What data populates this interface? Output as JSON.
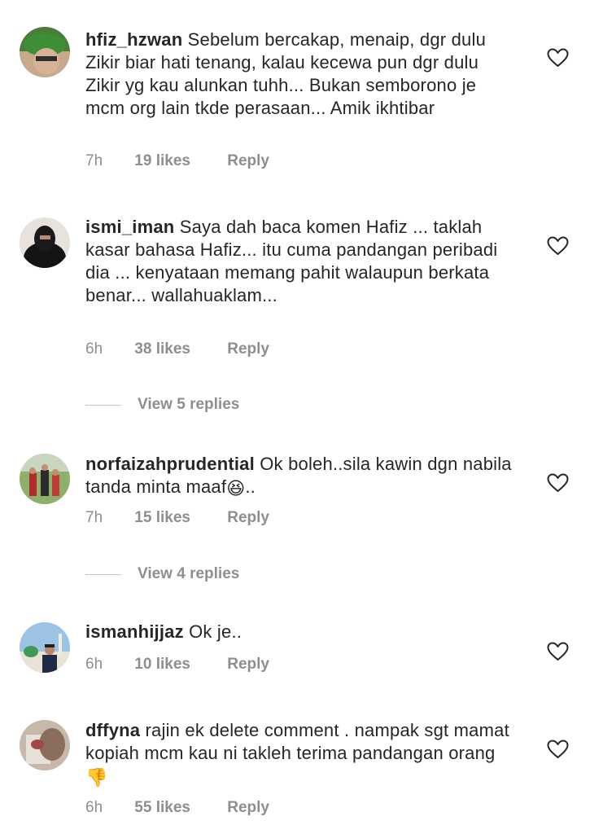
{
  "comments": [
    {
      "username": "hfiz_hzwan",
      "text": "Sebelum bercakap, menaip, dgr dulu Zikir biar hati tenang, kalau kecewa pun dgr dulu Zikir yg kau alunkan tuhh... Bukan semborono je mcm org lain tkde perasaan... Amik ikhtibar",
      "emoji": "",
      "time": "7h",
      "likes": "19 likes",
      "reply": "Reply"
    },
    {
      "username": "ismi_iman",
      "text": "Saya dah baca komen Hafiz ... taklah kasar bahasa Hafiz... itu cuma pandangan peribadi dia ... kenyataan memang pahit walaupun berkata benar... wallahuaklam...",
      "emoji": "",
      "time": "6h",
      "likes": "38 likes",
      "reply": "Reply",
      "view_replies": "View 5 replies"
    },
    {
      "username": "norfaizahprudential",
      "text": "Ok boleh..sila kawin dgn nabila tanda minta maaf",
      "emoji": "😆",
      "text_after": "..",
      "time": "7h",
      "likes": "15 likes",
      "reply": "Reply",
      "view_replies": "View 4 replies"
    },
    {
      "username": "ismanhijjaz",
      "text": "Ok je..",
      "emoji": "",
      "time": "6h",
      "likes": "10 likes",
      "reply": "Reply"
    },
    {
      "username": "dffyna",
      "text": "rajin ek delete comment . nampak sgt mamat kopiah mcm kau ni takleh terima pandangan orang",
      "emoji": "👎",
      "time": "6h",
      "likes": "55 likes",
      "reply": "Reply"
    }
  ],
  "icons": {
    "heart": "heart-outline-icon"
  },
  "colors": {
    "text": "#262626",
    "secondary": "#8e8e8e",
    "divider": "#c7c7c7"
  }
}
